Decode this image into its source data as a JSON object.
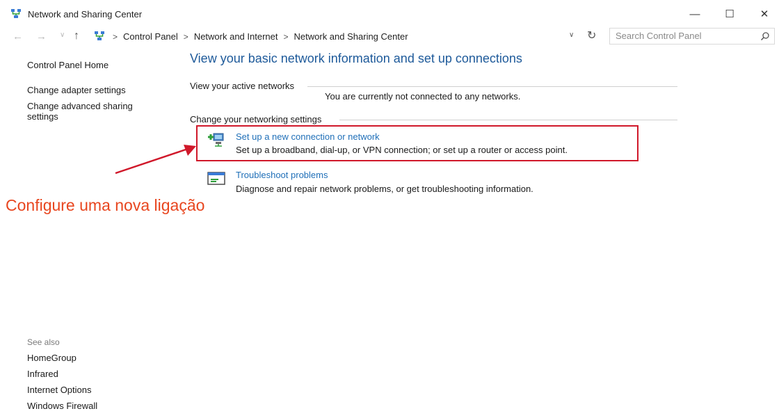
{
  "window": {
    "title": "Network and Sharing Center",
    "controls": {
      "minimize": "—",
      "maximize": "☐",
      "close": "✕"
    }
  },
  "navigation": {
    "back": "←",
    "forward": "→",
    "up": "↑",
    "breadcrumbs": [
      "Control Panel",
      "Network and Internet",
      "Network and Sharing Center"
    ],
    "separator": ">",
    "dropdown": "∨",
    "refresh": "↻"
  },
  "search": {
    "placeholder": "Search Control Panel"
  },
  "left_pane": {
    "home": "Control Panel Home",
    "links": [
      "Change adapter settings",
      "Change advanced sharing settings"
    ]
  },
  "see_also": {
    "heading": "See also",
    "links": [
      "HomeGroup",
      "Infrared",
      "Internet Options",
      "Windows Firewall"
    ]
  },
  "main": {
    "title": "View your basic network information and set up connections",
    "active_networks_label": "View your active networks",
    "active_networks_status": "You are currently not connected to any networks.",
    "change_settings_label": "Change your networking settings",
    "tasks": [
      {
        "link": "Set up a new connection or network",
        "description": "Set up a broadband, dial-up, or VPN connection; or set up a router or access point."
      },
      {
        "link": "Troubleshoot problems",
        "description": "Diagnose and repair network problems, or get troubleshooting information."
      }
    ]
  },
  "annotation": {
    "text": "Configure uma nova ligação",
    "color": "#e8461f"
  },
  "colors": {
    "link": "#1f6fb8",
    "title": "#1e5a9a",
    "highlight": "#d0182a"
  },
  "icons": [
    "network-sharing-icon",
    "setup-connection-icon",
    "troubleshoot-icon",
    "search-icon"
  ]
}
